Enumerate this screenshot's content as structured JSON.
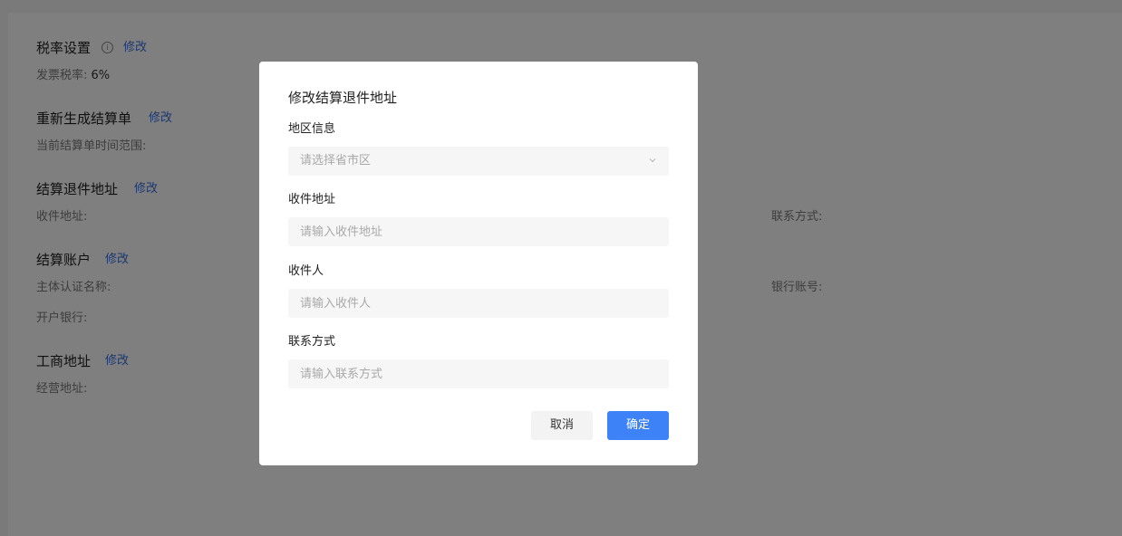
{
  "background": {
    "tax": {
      "title": "税率设置",
      "info_icon": "info-icon",
      "edit_label": "修改",
      "rate_label": "发票税率:",
      "rate_value": "6%"
    },
    "regenerate": {
      "title": "重新生成结算单",
      "edit_label": "修改",
      "range_label": "当前结算单时间范围:"
    },
    "return_address": {
      "title": "结算退件地址",
      "edit_label": "修改",
      "address_label": "收件地址:",
      "contact_label": "联系方式:"
    },
    "account": {
      "title": "结算账户",
      "edit_label": "修改",
      "entity_label": "主体认证名称:",
      "bank_account_label": "银行账号:",
      "bank_label": "开户银行:"
    },
    "business_address": {
      "title": "工商地址",
      "edit_label": "修改",
      "address_label": "经营地址:"
    }
  },
  "modal": {
    "title": "修改结算退件地址",
    "region": {
      "label": "地区信息",
      "placeholder": "请选择省市区",
      "icon": "chevron-down-icon"
    },
    "address": {
      "label": "收件地址",
      "placeholder": "请输入收件地址",
      "value": ""
    },
    "recipient": {
      "label": "收件人",
      "placeholder": "请输入收件人",
      "value": ""
    },
    "contact": {
      "label": "联系方式",
      "placeholder": "请输入联系方式",
      "value": ""
    },
    "cancel_label": "取消",
    "confirm_label": "确定"
  },
  "colors": {
    "link": "#3a6fd8",
    "primary": "#3d82f7",
    "overlay": "rgba(0,0,0,0.5)"
  }
}
